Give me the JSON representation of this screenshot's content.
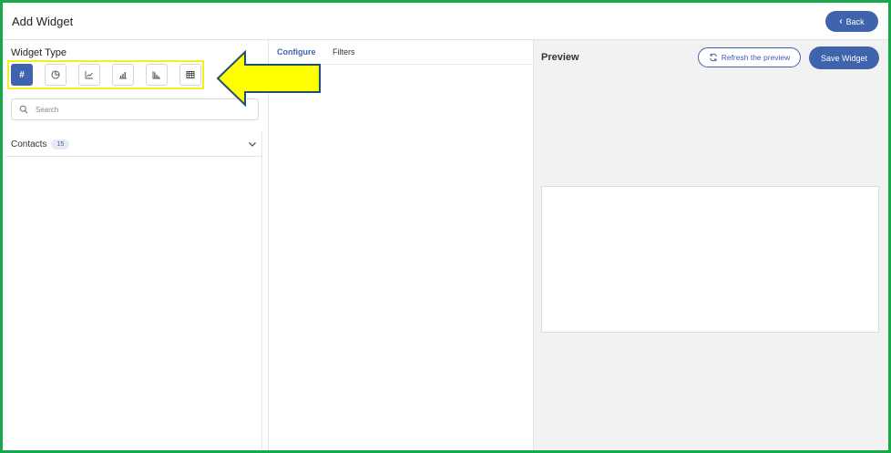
{
  "header": {
    "title": "Add Widget",
    "back_label": "Back"
  },
  "left_panel": {
    "widget_type_label": "Widget Type",
    "widget_types": [
      {
        "icon": "hash-icon",
        "glyph": "#",
        "active": true
      },
      {
        "icon": "pie-chart-icon",
        "active": false
      },
      {
        "icon": "line-chart-icon",
        "active": false
      },
      {
        "icon": "bar-chart-icon",
        "active": false
      },
      {
        "icon": "horizontal-bar-chart-icon",
        "active": false
      },
      {
        "icon": "table-icon",
        "active": false
      }
    ],
    "search": {
      "placeholder": "Search",
      "value": ""
    },
    "sections": [
      {
        "label": "Contacts",
        "count": "15"
      }
    ]
  },
  "middle_panel": {
    "tabs": [
      {
        "label": "Configure",
        "active": true
      },
      {
        "label": "Filters",
        "active": false
      }
    ]
  },
  "right_panel": {
    "preview_title": "Preview",
    "refresh_label": "Refresh the preview",
    "save_label": "Save Widget"
  },
  "colors": {
    "accent": "#3f63ad",
    "frame": "#17a84a",
    "highlight": "#f5ee1e",
    "arrow_fill": "#ffff00",
    "arrow_stroke": "#1f4e79"
  }
}
